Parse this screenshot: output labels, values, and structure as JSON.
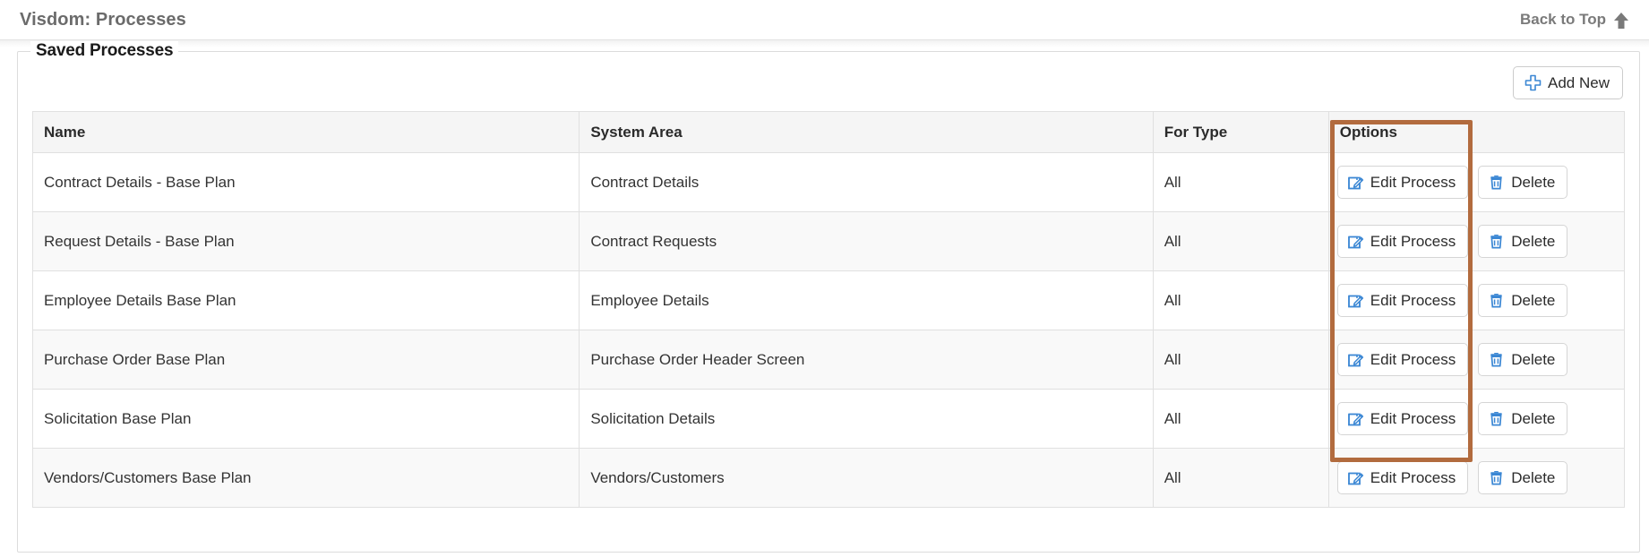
{
  "topbar": {
    "title": "Visdom: Processes",
    "back_to_top_label": "Back to Top",
    "back_to_top_icon": "arrow-up-icon"
  },
  "panel": {
    "legend": "Saved Processes",
    "add_new": {
      "label": "Add New",
      "icon": "plus-icon"
    }
  },
  "table": {
    "columns": [
      "Name",
      "System Area",
      "For Type",
      "Options"
    ],
    "row_actions": {
      "edit_label": "Edit Process",
      "edit_icon": "edit-pencil-icon",
      "delete_label": "Delete",
      "delete_icon": "trash-icon"
    },
    "rows": [
      {
        "name": "Contract Details - Base Plan",
        "system_area": "Contract Details",
        "for_type": "All"
      },
      {
        "name": "Request Details - Base Plan",
        "system_area": "Contract Requests",
        "for_type": "All"
      },
      {
        "name": "Employee Details Base Plan",
        "system_area": "Employee Details",
        "for_type": "All"
      },
      {
        "name": "Purchase Order Base Plan",
        "system_area": "Purchase Order Header Screen",
        "for_type": "All"
      },
      {
        "name": "Solicitation Base Plan",
        "system_area": "Solicitation Details",
        "for_type": "All"
      },
      {
        "name": "Vendors/Customers Base Plan",
        "system_area": "Vendors/Customers",
        "for_type": "All"
      }
    ]
  },
  "annotation": {
    "highlight_color": "#b26b3e",
    "highlight_target": "edit-process-buttons-column"
  },
  "colors": {
    "accent_blue": "#3b87d4",
    "header_bg": "#f5f5f5",
    "stripe_bg": "#f9f9f9",
    "border": "#e0e0e0",
    "title_text": "#6b6b6b"
  }
}
